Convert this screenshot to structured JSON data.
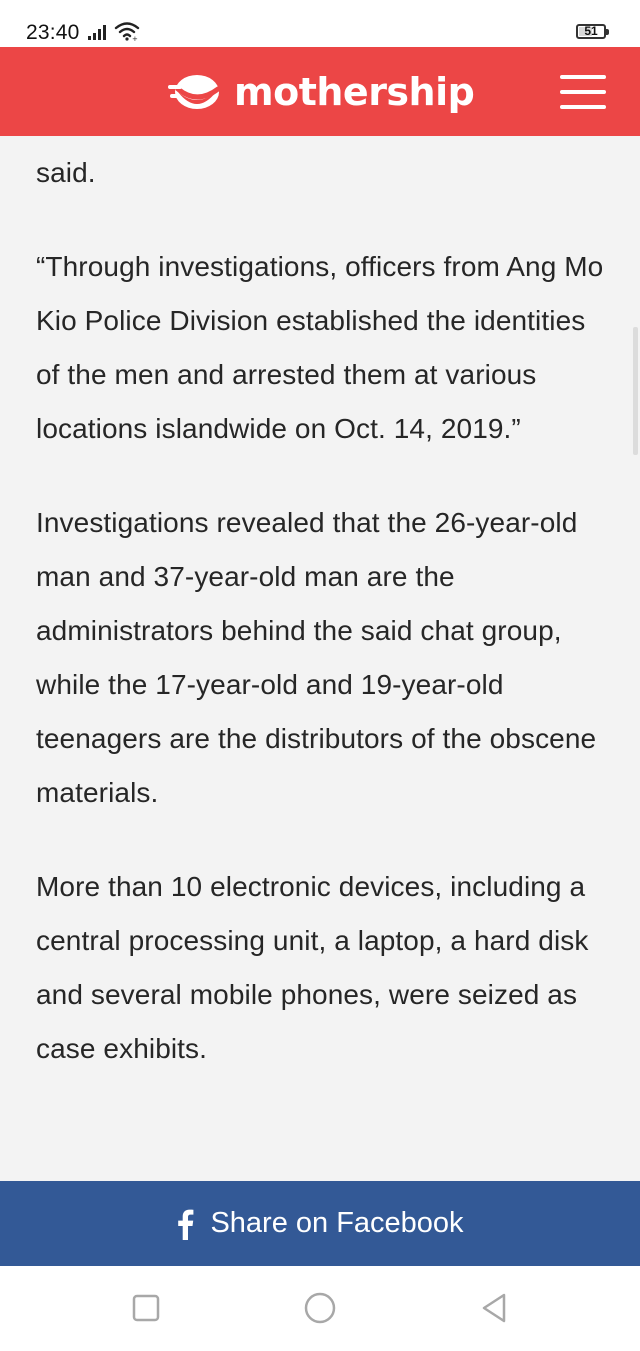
{
  "status_bar": {
    "time": "23:40",
    "battery": "51",
    "icons": [
      "signal-icon",
      "wifi-icon",
      "battery-icon"
    ]
  },
  "header": {
    "logo_text": "mothership",
    "logo_icon": "mothership-logo-icon",
    "menu_icon": "hamburger-menu-icon",
    "background_color": "#ec4646"
  },
  "article": {
    "paragraphs": [
      "said.",
      "“Through investigations, officers from Ang Mo Kio Police Division established the identities of the men and arrested them at various locations islandwide on Oct. 14, 2019.”",
      "Investigations revealed that the 26-year-old man and 37-year-old man are the administrators behind the said chat group, while the 17-year-old and 19-year-old teenagers are the distributors of the obscene materials.",
      "More than 10 electronic devices, including a central processing unit, a laptop, a hard disk and several mobile phones, were seized as case exhibits."
    ]
  },
  "share": {
    "label": "Share on Facebook",
    "icon": "facebook-icon",
    "color": "#335996"
  },
  "nav_bar": {
    "buttons": [
      "recent-apps-icon",
      "home-icon",
      "back-icon"
    ]
  }
}
